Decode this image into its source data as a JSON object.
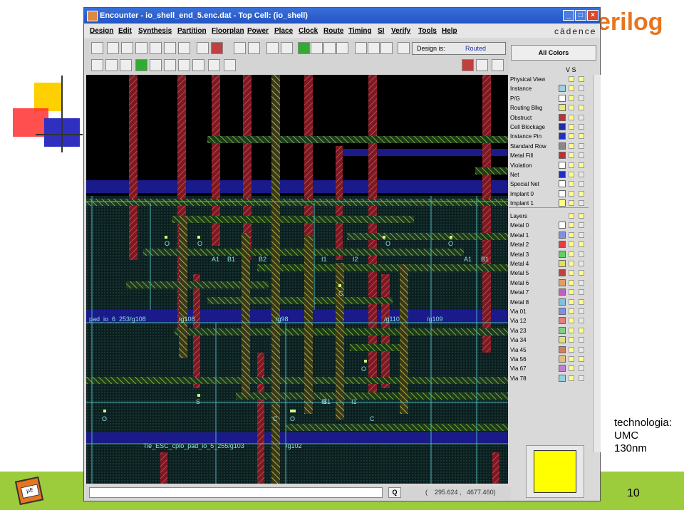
{
  "slide": {
    "logo_text": "erilog",
    "tech_note_lines": [
      "technologia:",
      "UMC",
      "130nm"
    ],
    "slide_number": "10",
    "corner_logo_text": "µE"
  },
  "window": {
    "title": "Encounter - io_shell_end_5.enc.dat - Top Cell: (io_shell)",
    "menu": [
      "Design",
      "Edit",
      "Synthesis",
      "Partition",
      "Floorplan",
      "Power",
      "Place",
      "Clock",
      "Route",
      "Timing",
      "SI",
      "Verify",
      "Tools",
      "Help"
    ],
    "brand": "cādence",
    "status_label": "Design is:",
    "status_value": "Routed",
    "all_colors_label": "All Colors",
    "vs_header": "V  S",
    "command_button": "Q",
    "coordinates": "(    295.624 ,   4677.460)"
  },
  "layers_physical": [
    {
      "name": "Physical View",
      "color": ""
    },
    {
      "name": "Instance",
      "color": "#9fd0e0"
    },
    {
      "name": "P/G",
      "color": "#ffffff"
    },
    {
      "name": "Routing Blkg",
      "color": "#e8e880"
    },
    {
      "name": "Obstruct",
      "color": "#c03030"
    },
    {
      "name": "Cell Blockage",
      "color": "#2030a0"
    },
    {
      "name": "Instance Pin",
      "color": "#2030c0"
    },
    {
      "name": "Standard Row",
      "color": "#888888"
    },
    {
      "name": "Metal Fill",
      "color": "#c03030"
    },
    {
      "name": "Violation",
      "color": "#ffffff"
    },
    {
      "name": "Net",
      "color": "#2030c0"
    },
    {
      "name": "Special Net",
      "color": "#ffffff"
    },
    {
      "name": "Implant 0",
      "color": "#ffffff"
    },
    {
      "name": "Implant 1",
      "color": "#ffff80"
    }
  ],
  "layers_metal": [
    {
      "name": "Layers",
      "color": ""
    },
    {
      "name": "Metal 0",
      "color": "#ffffff"
    },
    {
      "name": "Metal 1",
      "color": "#8090e0"
    },
    {
      "name": "Metal 2",
      "color": "#e04040"
    },
    {
      "name": "Metal 3",
      "color": "#60d060"
    },
    {
      "name": "Metal 4",
      "color": "#e0e060"
    },
    {
      "name": "Metal 5",
      "color": "#c04040"
    },
    {
      "name": "Metal 6",
      "color": "#e0a060"
    },
    {
      "name": "Metal 7",
      "color": "#c060c0"
    },
    {
      "name": "Metal 8",
      "color": "#80c0e0"
    },
    {
      "name": "Via 01",
      "color": "#8090e0"
    },
    {
      "name": "Via 12",
      "color": "#e08080"
    },
    {
      "name": "Via 23",
      "color": "#80d080"
    },
    {
      "name": "Via 34",
      "color": "#e0e080"
    },
    {
      "name": "Via 45",
      "color": "#d08060"
    },
    {
      "name": "Via 56",
      "color": "#e0c080"
    },
    {
      "name": "Via 67",
      "color": "#c080d0"
    },
    {
      "name": "Via 78",
      "color": "#90d0e0"
    }
  ],
  "layout_labels": [
    "pad_io_6_253/g108",
    "/g108",
    "/g98",
    "/g110",
    "/g109",
    "Tie_ESC_cplo_pad_io_5_255/g103",
    "/g102",
    "O",
    "O",
    "A1",
    "B1",
    "B2",
    "I1",
    "I2",
    "O",
    "O",
    "A1",
    "B1",
    "C",
    "I1",
    "B1",
    "S",
    "O",
    "C",
    "O",
    "I1",
    "C",
    "O"
  ]
}
